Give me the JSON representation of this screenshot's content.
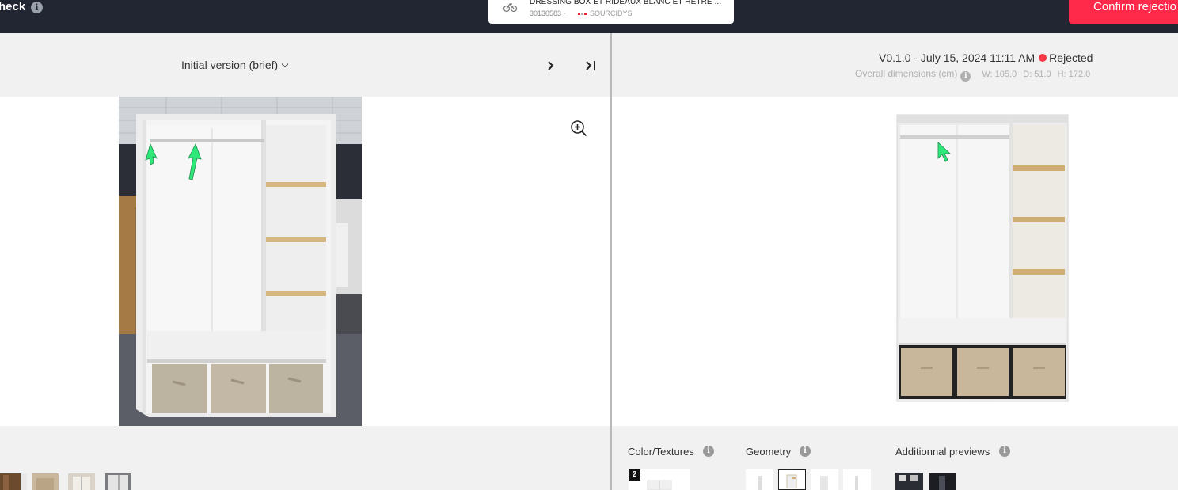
{
  "app": {
    "title_fragment": "heck",
    "info_icon": "i"
  },
  "product": {
    "icon": "product-type-icon",
    "name": "DRESSING BOX ET RIDEAUX BLANC ET HETRE ...",
    "reference": "30130583 ·",
    "supplier": "SOURCIDYS"
  },
  "actions": {
    "confirm_rejection_label": "Confirm rejectio"
  },
  "left_panel": {
    "version_select_label": "Initial version (brief)",
    "next_icon": "chevron-right-icon",
    "last_icon": "skip-to-last-icon",
    "zoom_icon": "zoom-in-icon",
    "thumbnail_count": 4
  },
  "right_panel": {
    "version_label": "V0.1.0 - July 15, 2024 11:11 AM",
    "status": "Rejected",
    "status_color": "#f53845",
    "dimensions_label": "Overall dimensions (cm)",
    "dimensions_info": "i",
    "dim_w": "W: 105.0",
    "dim_d": "D: 51.0",
    "dim_h": "H: 172.0"
  },
  "footer": {
    "color_textures_label": "Color/Textures",
    "color_textures_count": "2",
    "geometry_label": "Geometry",
    "additional_previews_label": "Additionnal previews",
    "info_glyph": "i"
  },
  "colors": {
    "topbar": "#222632",
    "accent": "#ff2a4a",
    "panel_bg": "#f1f1f1",
    "annotation_arrow": "#2ee87a"
  }
}
